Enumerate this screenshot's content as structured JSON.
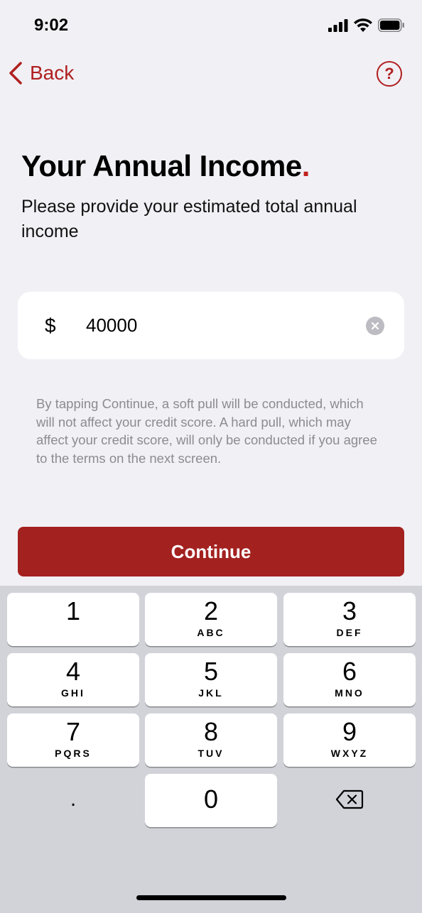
{
  "status_bar": {
    "time": "9:02"
  },
  "nav": {
    "back_label": "Back",
    "help_label": "?"
  },
  "header": {
    "title": "Your Annual Income",
    "title_dot": ".",
    "subtitle": "Please provide your estimated total annual income"
  },
  "income_field": {
    "currency": "$",
    "value": "40000"
  },
  "disclaimer": "By tapping Continue, a soft pull will be conducted, which will not affect your credit score. A hard pull, which may affect your credit score, will only be conducted if you agree to the terms on the next screen.",
  "continue_label": "Continue",
  "keypad": {
    "keys": [
      {
        "digit": "1",
        "letters": ""
      },
      {
        "digit": "2",
        "letters": "ABC"
      },
      {
        "digit": "3",
        "letters": "DEF"
      },
      {
        "digit": "4",
        "letters": "GHI"
      },
      {
        "digit": "5",
        "letters": "JKL"
      },
      {
        "digit": "6",
        "letters": "MNO"
      },
      {
        "digit": "7",
        "letters": "PQRS"
      },
      {
        "digit": "8",
        "letters": "TUV"
      },
      {
        "digit": "9",
        "letters": "WXYZ"
      }
    ],
    "decimal": ".",
    "zero": "0"
  },
  "colors": {
    "accent": "#a3211f",
    "background": "#f1f0f5",
    "keyboard": "#d1d3d9"
  }
}
